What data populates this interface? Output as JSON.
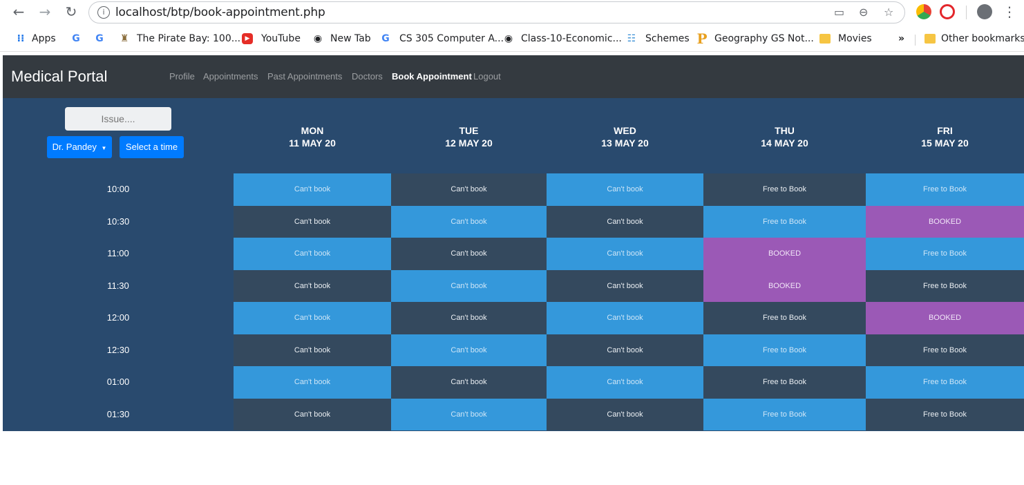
{
  "browser": {
    "url": "localhost/btp/book-appointment.php",
    "bookmarks": [
      {
        "label": "Apps",
        "icon": "apps-grid-icon"
      },
      {
        "label": "",
        "icon": "google-icon"
      },
      {
        "label": "",
        "icon": "google-icon"
      },
      {
        "label": "The Pirate Bay: 100...",
        "icon": "pirate-ship-icon"
      },
      {
        "label": "YouTube",
        "icon": "youtube-icon"
      },
      {
        "label": "New Tab",
        "icon": "globe-icon"
      },
      {
        "label": "CS 305 Computer A...",
        "icon": "google-icon"
      },
      {
        "label": "Class-10-Economic...",
        "icon": "globe-icon"
      },
      {
        "label": "Schemes",
        "icon": "schemes-icon"
      },
      {
        "label": "Geography GS Not...",
        "icon": "p-logo-icon"
      },
      {
        "label": "Movies",
        "icon": "folder-icon"
      },
      {
        "label": "Other bookmarks",
        "icon": "folder-icon"
      }
    ],
    "overflow_label": "»"
  },
  "app": {
    "brand": "Medical Portal",
    "nav": [
      "Profile",
      "Appointments",
      "Past Appointments",
      "Doctors",
      "Book Appointment",
      "Logout"
    ],
    "active_nav": "Book Appointment"
  },
  "controls": {
    "issue_placeholder": "Issue....",
    "doctor": "Dr. Pandey",
    "select_time": "Select a time"
  },
  "days": [
    {
      "day": "MON",
      "date": "11 MAY 20"
    },
    {
      "day": "TUE",
      "date": "12 MAY 20"
    },
    {
      "day": "WED",
      "date": "13 MAY 20"
    },
    {
      "day": "THU",
      "date": "14 MAY 20"
    },
    {
      "day": "FRI",
      "date": "15 MAY 20"
    }
  ],
  "times": [
    "10:00",
    "10:30",
    "11:00",
    "11:30",
    "12:00",
    "12:30",
    "01:00",
    "01:30"
  ],
  "slots": [
    [
      {
        "t": "Can't book",
        "s": "blue"
      },
      {
        "t": "Can't book",
        "s": "dark"
      },
      {
        "t": "Can't book",
        "s": "blue"
      },
      {
        "t": "Free to Book",
        "s": "dark"
      },
      {
        "t": "Free to Book",
        "s": "blue"
      }
    ],
    [
      {
        "t": "Can't book",
        "s": "dark"
      },
      {
        "t": "Can't book",
        "s": "blue"
      },
      {
        "t": "Can't book",
        "s": "dark"
      },
      {
        "t": "Free to Book",
        "s": "blue"
      },
      {
        "t": "BOOKED",
        "s": "booked"
      }
    ],
    [
      {
        "t": "Can't book",
        "s": "blue"
      },
      {
        "t": "Can't book",
        "s": "dark"
      },
      {
        "t": "Can't book",
        "s": "blue"
      },
      {
        "t": "BOOKED",
        "s": "booked"
      },
      {
        "t": "Free to Book",
        "s": "blue"
      }
    ],
    [
      {
        "t": "Can't book",
        "s": "dark"
      },
      {
        "t": "Can't book",
        "s": "blue"
      },
      {
        "t": "Can't book",
        "s": "dark"
      },
      {
        "t": "BOOKED",
        "s": "booked"
      },
      {
        "t": "Free to Book",
        "s": "dark"
      }
    ],
    [
      {
        "t": "Can't book",
        "s": "blue"
      },
      {
        "t": "Can't book",
        "s": "dark"
      },
      {
        "t": "Can't book",
        "s": "blue"
      },
      {
        "t": "Free to Book",
        "s": "dark"
      },
      {
        "t": "BOOKED",
        "s": "booked"
      }
    ],
    [
      {
        "t": "Can't book",
        "s": "dark"
      },
      {
        "t": "Can't book",
        "s": "blue"
      },
      {
        "t": "Can't book",
        "s": "dark"
      },
      {
        "t": "Free to Book",
        "s": "blue"
      },
      {
        "t": "Free to Book",
        "s": "dark"
      }
    ],
    [
      {
        "t": "Can't book",
        "s": "blue"
      },
      {
        "t": "Can't book",
        "s": "dark"
      },
      {
        "t": "Can't book",
        "s": "blue"
      },
      {
        "t": "Free to Book",
        "s": "dark"
      },
      {
        "t": "Free to Book",
        "s": "blue"
      }
    ],
    [
      {
        "t": "Can't book",
        "s": "dark"
      },
      {
        "t": "Can't book",
        "s": "blue"
      },
      {
        "t": "Can't book",
        "s": "dark"
      },
      {
        "t": "Free to Book",
        "s": "blue"
      },
      {
        "t": "Free to Book",
        "s": "dark"
      }
    ]
  ],
  "colors": {
    "navbar": "#343a40",
    "calendar_bg": "#294a6e",
    "slot_blue": "#3498db",
    "slot_dark": "#34495e",
    "slot_booked": "#9b59b6",
    "button": "#007bff"
  }
}
